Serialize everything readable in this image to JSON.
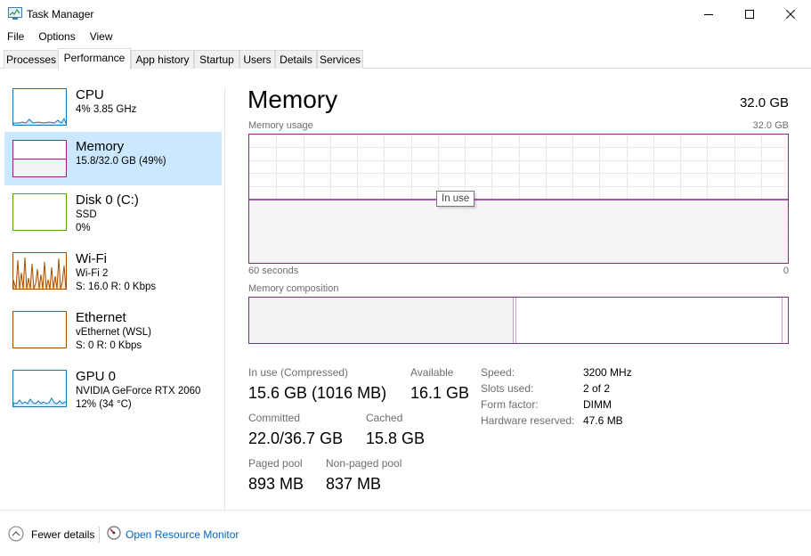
{
  "window": {
    "title": "Task Manager",
    "icon": "task-manager-icon",
    "controls": [
      "minimize-icon",
      "maximize-icon",
      "close-icon"
    ]
  },
  "menu": [
    "File",
    "Options",
    "View"
  ],
  "tabs": [
    "Processes",
    "Performance",
    "App history",
    "Startup",
    "Users",
    "Details",
    "Services"
  ],
  "active_tab": "Performance",
  "resources": [
    {
      "name": "CPU",
      "line1": "4%  3.85 GHz",
      "line2": "",
      "color": "#1779ba"
    },
    {
      "name": "Memory",
      "line1": "15.8/32.0 GB (49%)",
      "line2": "",
      "color": "#8b2596",
      "selected": true,
      "fill_fraction": 0.49
    },
    {
      "name": "Disk 0 (C:)",
      "line1": "SSD",
      "line2": "0%",
      "color": "#4da60c"
    },
    {
      "name": "Wi-Fi",
      "line1": "Wi-Fi 2",
      "line2": "S: 16.0  R: 0 Kbps",
      "color": "#a74f01"
    },
    {
      "name": "Ethernet",
      "line1": "vEthernet (WSL)",
      "line2": "S: 0  R: 0 Kbps",
      "color": "#a74f01"
    },
    {
      "name": "GPU 0",
      "line1": "NVIDIA GeForce RTX 2060",
      "line2": "12%  (34 °C)",
      "color": "#1779ba"
    }
  ],
  "detail": {
    "title": "Memory",
    "total": "32.0 GB",
    "usage_label": "Memory usage",
    "usage_max": "32.0 GB",
    "time_left": "60 seconds",
    "time_right": "0",
    "tooltip": "In use",
    "usage_fraction": 0.49,
    "composition_label": "Memory composition",
    "composition": {
      "in_use_fraction": 0.49,
      "modified_fraction": 0.005,
      "standby_fraction": 0.493,
      "free_fraction": 0.012
    },
    "accent": "#8b2596",
    "fill": "#f4f2f4"
  },
  "stats": {
    "in_use_label": "In use (Compressed)",
    "in_use_value": "15.6 GB (1016 MB)",
    "available_label": "Available",
    "available_value": "16.1 GB",
    "committed_label": "Committed",
    "committed_value": "22.0/36.7 GB",
    "cached_label": "Cached",
    "cached_value": "15.8 GB",
    "paged_label": "Paged pool",
    "paged_value": "893 MB",
    "nonpaged_label": "Non-paged pool",
    "nonpaged_value": "837 MB"
  },
  "specs": [
    {
      "key": "Speed:",
      "value": "3200 MHz"
    },
    {
      "key": "Slots used:",
      "value": "2 of 2"
    },
    {
      "key": "Form factor:",
      "value": "DIMM"
    },
    {
      "key": "Hardware reserved:",
      "value": "47.6 MB"
    }
  ],
  "footer": {
    "fewer_details": "Fewer details",
    "fewer_icon": "chevron-up-circle-icon",
    "resource_monitor": "Open Resource Monitor",
    "resource_monitor_icon": "resource-monitor-icon"
  }
}
